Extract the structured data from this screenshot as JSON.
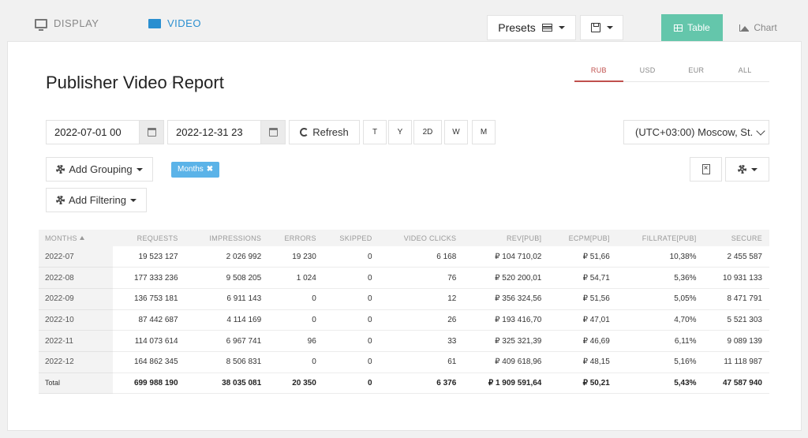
{
  "nav": {
    "display_label": "DISPLAY",
    "video_label": "VIDEO",
    "presets_label": "Presets",
    "table_label": "Table",
    "chart_label": "Chart",
    "icons": [
      "monitor-icon",
      "video-camera-icon",
      "table-icon",
      "floppy-disk-icon",
      "grid-icon",
      "area-chart-icon"
    ]
  },
  "page": {
    "title": "Publisher Video Report",
    "accent_color": "#c0504d",
    "table_view_color": "#64c6ab",
    "chip_color": "#5bb3e8"
  },
  "currency_tabs": [
    "RUB",
    "USD",
    "EUR",
    "ALL"
  ],
  "currency_active": "RUB",
  "filters": {
    "date_from": "2022-07-01 00",
    "date_to": "2022-12-31 23",
    "refresh_label": "Refresh",
    "ranges": [
      "T",
      "Y",
      "2D",
      "W",
      "M"
    ],
    "timezone": "(UTC+03:00) Moscow, St.",
    "add_grouping_label": "Add Grouping",
    "add_filtering_label": "Add Filtering",
    "grouping_chip": "Months",
    "chip_close": "✖"
  },
  "table": {
    "columns": [
      "MONTHS",
      "REQUESTS",
      "IMPRESSIONS",
      "ERRORS",
      "SKIPPED",
      "VIDEO CLICKS",
      "REV[PUB]",
      "ECPM[PUB]",
      "FILLRATE[PUB]",
      "SECURE"
    ],
    "rows": [
      [
        "2022-07",
        "19 523 127",
        "2 026 992",
        "19 230",
        "0",
        "6 168",
        "₽ 104 710,02",
        "₽ 51,66",
        "10,38%",
        "2 455 587"
      ],
      [
        "2022-08",
        "177 333 236",
        "9 508 205",
        "1 024",
        "0",
        "76",
        "₽ 520 200,01",
        "₽ 54,71",
        "5,36%",
        "10 931 133"
      ],
      [
        "2022-09",
        "136 753 181",
        "6 911 143",
        "0",
        "0",
        "12",
        "₽ 356 324,56",
        "₽ 51,56",
        "5,05%",
        "8 471 791"
      ],
      [
        "2022-10",
        "87 442 687",
        "4 114 169",
        "0",
        "0",
        "26",
        "₽ 193 416,70",
        "₽ 47,01",
        "4,70%",
        "5 521 303"
      ],
      [
        "2022-11",
        "114 073 614",
        "6 967 741",
        "96",
        "0",
        "33",
        "₽ 325 321,39",
        "₽ 46,69",
        "6,11%",
        "9 089 139"
      ],
      [
        "2022-12",
        "164 862 345",
        "8 506 831",
        "0",
        "0",
        "61",
        "₽ 409 618,96",
        "₽ 48,15",
        "5,16%",
        "11 118 987"
      ]
    ],
    "total": [
      "Total",
      "699 988 190",
      "38 035 081",
      "20 350",
      "0",
      "6 376",
      "₽ 1 909 591,64",
      "₽ 50,21",
      "5,43%",
      "47 587 940"
    ]
  }
}
